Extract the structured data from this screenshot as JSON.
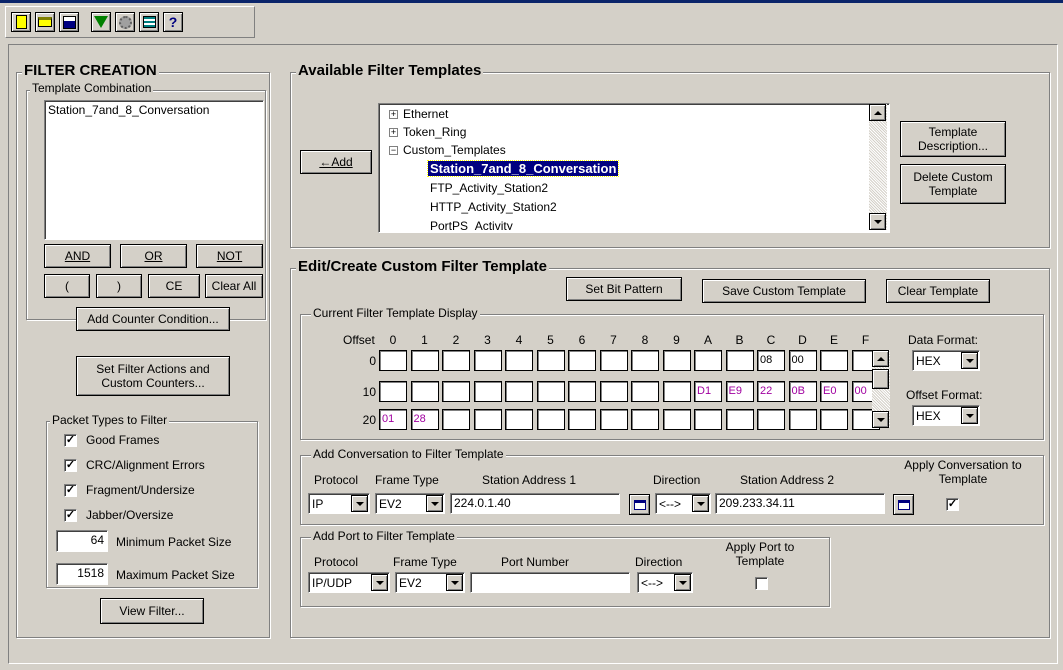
{
  "toolbar": {
    "buttons": [
      "new-icon",
      "open-icon",
      "save-icon",
      "filter-icon",
      "gear-icon",
      "template-list-icon",
      "help-icon"
    ],
    "help_glyph": "?"
  },
  "filter_creation": {
    "title": "FILTER CREATION",
    "template_combination_label": "Template Combination",
    "combination_text": "Station_7and_8_Conversation",
    "and": "AND",
    "or": "OR",
    "not": "NOT",
    "lparen": "(",
    "rparen": ")",
    "ce": "CE",
    "clear_all": "Clear All",
    "add_counter": "Add Counter Condition...",
    "set_actions": "Set Filter Actions and Custom Counters...",
    "packet_types_label": "Packet Types to Filter",
    "packet_types": [
      {
        "label": "Good Frames",
        "checked": true
      },
      {
        "label": "CRC/Alignment Errors",
        "checked": true
      },
      {
        "label": "Fragment/Undersize",
        "checked": true
      },
      {
        "label": "Jabber/Oversize",
        "checked": true
      }
    ],
    "min_size_value": "64",
    "min_size_label": "Minimum Packet Size",
    "max_size_value": "1518",
    "max_size_label": "Maximum Packet Size",
    "view_filter": "View Filter..."
  },
  "available_templates": {
    "title": "Available Filter Templates",
    "add": "Add",
    "tree": [
      {
        "label": "Ethernet",
        "expander": "+"
      },
      {
        "label": "Token_Ring",
        "expander": "+"
      },
      {
        "label": "Custom_Templates",
        "expander": "−"
      },
      {
        "label": "Station_7and_8_Conversation",
        "selected": true
      },
      {
        "label": "FTP_Activity_Station2"
      },
      {
        "label": "HTTP_Activity_Station2"
      },
      {
        "label": "PortPS_Activity"
      }
    ],
    "template_description": "Template Description...",
    "delete_custom": "Delete Custom Template"
  },
  "edit_template": {
    "title": "Edit/Create Custom Filter Template",
    "set_bit_pattern": "Set Bit Pattern",
    "save_custom": "Save Custom Template",
    "clear_template": "Clear Template",
    "display_label": "Current Filter Template Display",
    "offset_label": "Offset",
    "columns": [
      "0",
      "1",
      "2",
      "3",
      "4",
      "5",
      "6",
      "7",
      "8",
      "9",
      "A",
      "B",
      "C",
      "D",
      "E",
      "F"
    ],
    "rows": [
      {
        "label": "0",
        "cells": [
          "",
          "",
          "",
          "",
          "",
          "",
          "",
          "",
          "",
          "",
          "",
          "",
          "08",
          "00",
          "",
          ""
        ]
      },
      {
        "label": "10",
        "cells": [
          "",
          "",
          "",
          "",
          "",
          "",
          "",
          "",
          "",
          "",
          "D1",
          "E9",
          "22",
          "0B",
          "E0",
          "00"
        ]
      },
      {
        "label": "20",
        "cells": [
          "01",
          "28",
          "",
          "",
          "",
          "",
          "",
          "",
          "",
          "",
          "",
          "",
          "",
          "",
          "",
          ""
        ]
      }
    ],
    "data_format_label": "Data Format:",
    "data_format": "HEX",
    "offset_format_label": "Offset Format:",
    "offset_format": "HEX"
  },
  "conversation": {
    "title": "Add Conversation to Filter Template",
    "protocol_label": "Protocol",
    "frame_type_label": "Frame Type",
    "station1_label": "Station Address 1",
    "direction_label": "Direction",
    "station2_label": "Station Address 2",
    "apply_label": "Apply Conversation to Template",
    "protocol": "IP",
    "frame_type": "EV2",
    "station1": "224.0.1.40",
    "direction": "<-->",
    "station2": "209.233.34.11",
    "apply_checked": true
  },
  "port": {
    "title": "Add Port to Filter Template",
    "protocol_label": "Protocol",
    "frame_type_label": "Frame Type",
    "port_number_label": "Port Number",
    "direction_label": "Direction",
    "apply_label": "Apply Port to Template",
    "protocol": "IP/UDP",
    "frame_type": "EV2",
    "port_number": "",
    "direction": "<-->",
    "apply_checked": false
  },
  "colors": {
    "selection": "#000080",
    "hex_value": "#a000a0",
    "face": "#d4d0c8"
  }
}
